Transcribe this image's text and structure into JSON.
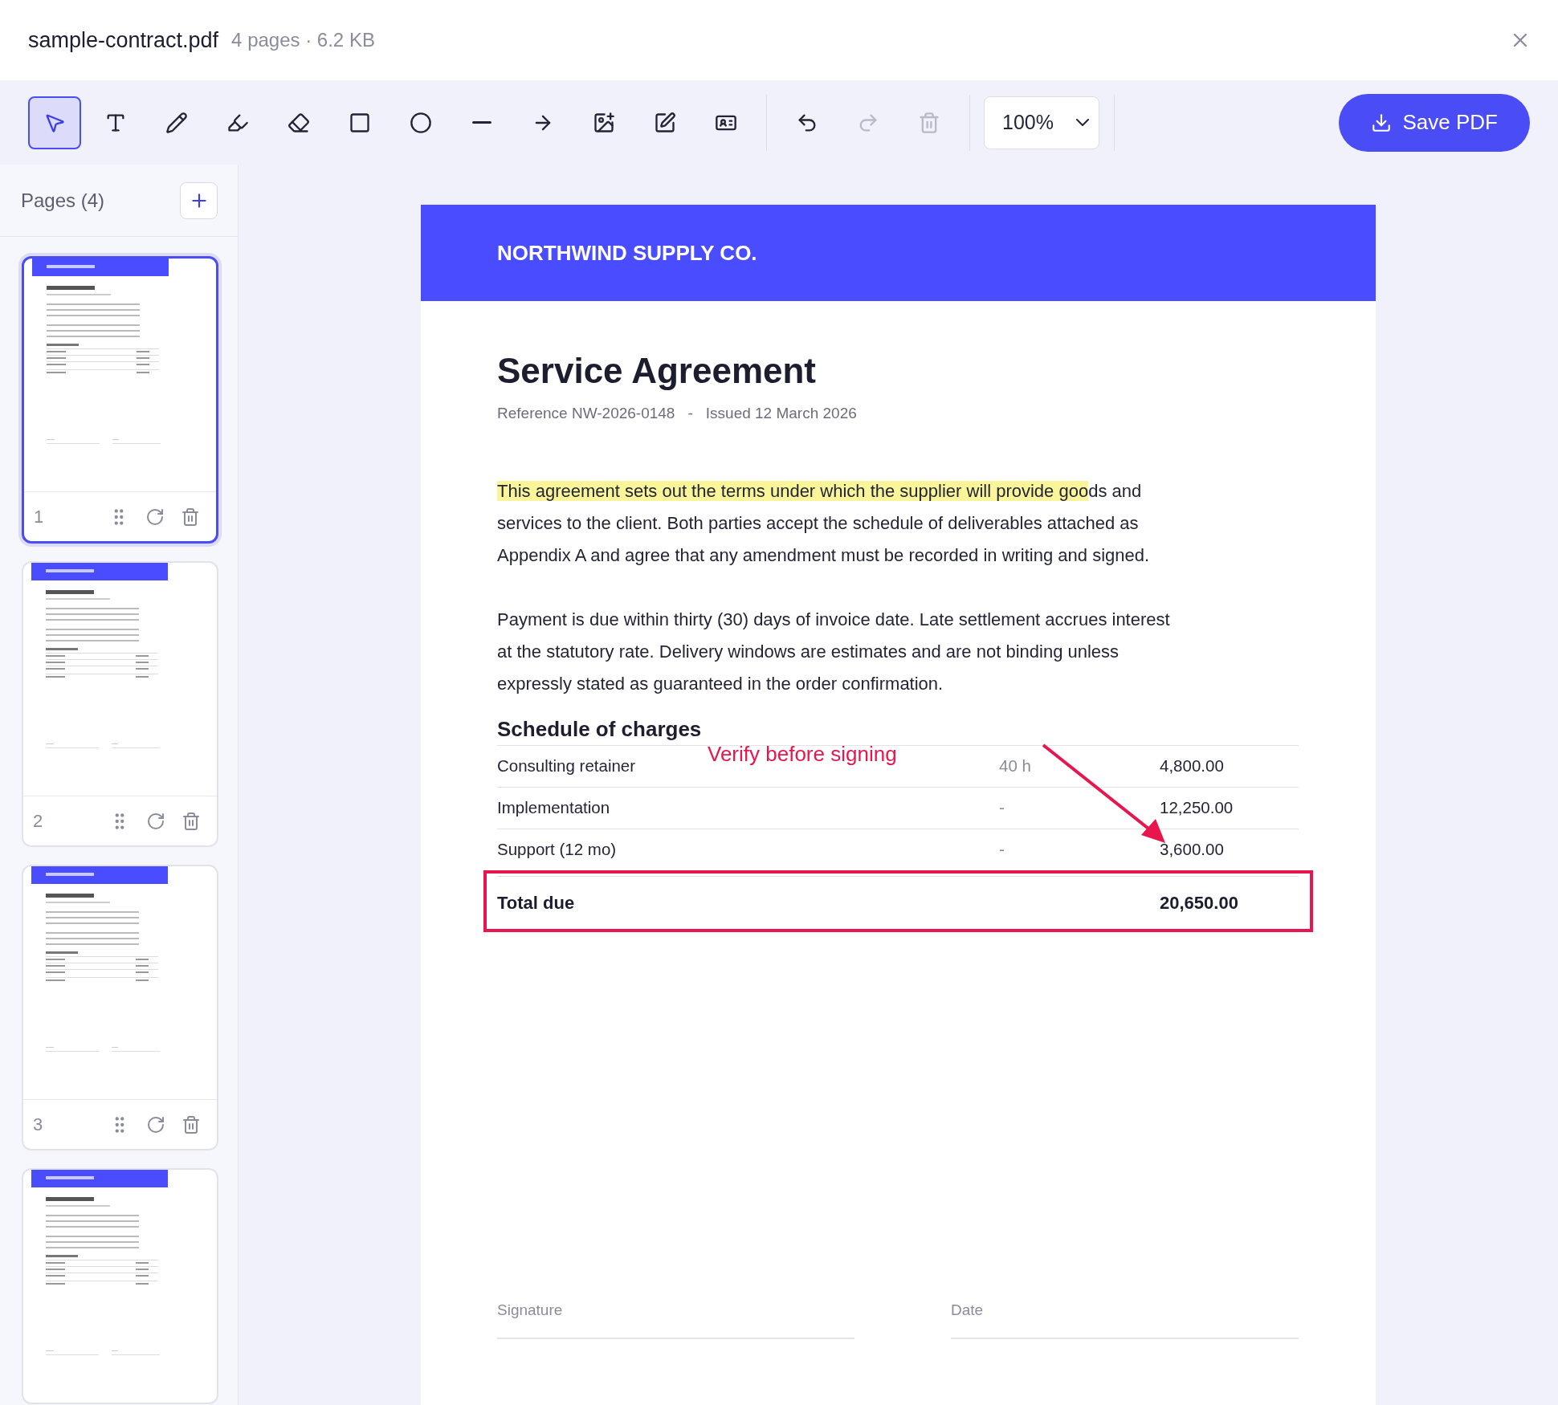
{
  "window": {
    "title": "sample-contract.pdf",
    "meta": "4 pages · 6.2 KB"
  },
  "toolbar": {
    "tools": [
      {
        "kind": "select",
        "selected": true
      },
      {
        "kind": "text",
        "selected": false
      },
      {
        "kind": "pencil",
        "selected": false
      },
      {
        "kind": "highlighter",
        "selected": false
      },
      {
        "kind": "eraser",
        "selected": false
      },
      {
        "kind": "rectangle",
        "selected": false
      },
      {
        "kind": "ellipse",
        "selected": false
      },
      {
        "kind": "line",
        "selected": false
      },
      {
        "kind": "arrow",
        "selected": false
      },
      {
        "kind": "image",
        "selected": false
      },
      {
        "kind": "note",
        "selected": false
      },
      {
        "kind": "card",
        "selected": false
      }
    ],
    "history": [
      {
        "kind": "undo",
        "disabled": false
      },
      {
        "kind": "redo",
        "disabled": true
      },
      {
        "kind": "delete",
        "disabled": true
      }
    ],
    "zoom": "100%",
    "save_button": "Save PDF"
  },
  "sidebar": {
    "title": "Pages (4)",
    "pages": [
      {
        "number": "1",
        "selected": true
      },
      {
        "number": "2",
        "selected": false
      },
      {
        "number": "3",
        "selected": false
      },
      {
        "selected": false
      }
    ]
  },
  "document": {
    "company": "NORTHWIND SUPPLY CO.",
    "title": "Service Agreement",
    "reference": "Reference NW-2026-0148",
    "separator": "-",
    "issued": "Issued 12 March 2026",
    "paragraphs": [
      {
        "highlight": "This agreement sets out the terms under which the supplier will provide goo",
        "text": "ds and services to the client. Both parties accept the schedule of deliverables attached as Appendix A and agree that any amendment must be recorded in writing and signed."
      },
      {
        "text": "Payment is due within thirty (30) days of invoice date. Late settlement accrues interest at the statutory rate. Delivery windows are estimates and are not binding unless expressly stated as guaranteed in the order confirmation."
      }
    ],
    "schedule": {
      "title": "Schedule of charges",
      "rows": [
        {
          "description": "Consulting retainer",
          "quantity": "40 h",
          "amount": "4,800.00"
        },
        {
          "description": "Implementation",
          "quantity": "-",
          "amount": "12,250.00"
        },
        {
          "description": "Support (12 mo)",
          "quantity": "-",
          "amount": "3,600.00"
        }
      ],
      "total": {
        "label": "Total due",
        "amount": "20,650.00"
      }
    },
    "signature_fields": [
      "Signature",
      "Date"
    ]
  },
  "annotations": [
    {
      "kind": "note",
      "text": "Verify before signing"
    },
    {
      "kind": "arrow"
    },
    {
      "kind": "rectangle"
    }
  ]
}
